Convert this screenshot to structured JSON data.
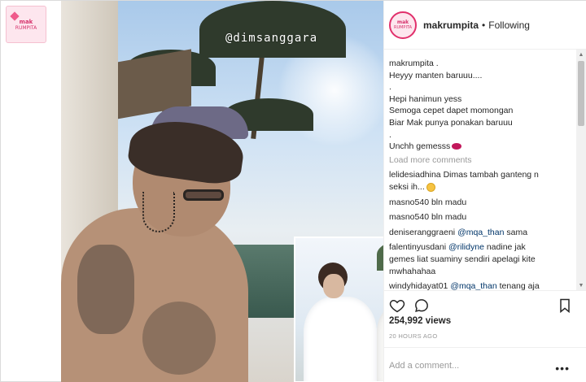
{
  "watermark": {
    "line1": "mak",
    "line2": "RUMPITA"
  },
  "photo": {
    "story_tag": "@dimsanggara"
  },
  "panel": {
    "username": "makrumpita",
    "separator": "•",
    "follow_status": "Following",
    "caption": {
      "user": "makrumpita .",
      "lines": [
        "Heyyy manten baruuu....",
        ".",
        "Hepi hanimun yess",
        "Semoga cepet dapet momongan",
        "Biar Mak punya ponakan baruuu",
        ".",
        "Unchh gemesss"
      ]
    },
    "load_more": "Load more comments",
    "comments": [
      {
        "user": "lelidesiadhina",
        "text": "Dimas tambah ganteng n",
        "text2": "seksi ih..."
      },
      {
        "user": "masno540",
        "text": "bln madu"
      },
      {
        "user": "masno540",
        "text": "bln madu"
      },
      {
        "user": "deniseranggraeni",
        "mention": "@mqa_than",
        "text": "sama"
      },
      {
        "user": "falentinyusdani",
        "mention": "@rilidyne",
        "text": "nadine jak",
        "text2": "gemes liat suaminy sendiri apelagi kite",
        "text3": "mwhahahaa"
      },
      {
        "user": "windyhidayat01",
        "mention": "@mqa_than",
        "text": "tenang aja"
      }
    ],
    "views": "254,992 views",
    "timestamp": "20 HOURS AGO",
    "add_comment_placeholder": "Add a comment...",
    "more_options": "•••"
  }
}
